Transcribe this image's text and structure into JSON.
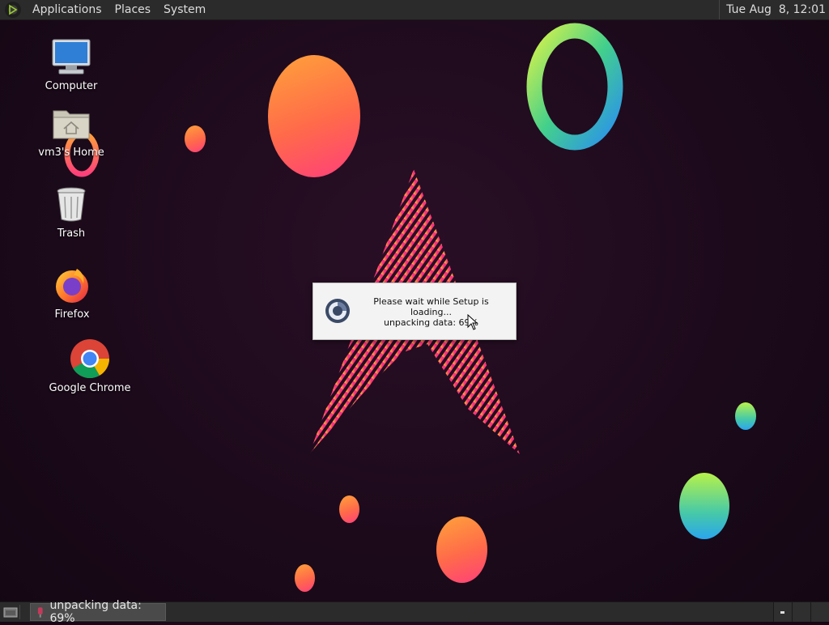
{
  "top_panel": {
    "menus": [
      "Applications",
      "Places",
      "System"
    ],
    "clock": "Tue Aug  8, 12:01"
  },
  "desktop": {
    "icons": [
      {
        "label": "Computer",
        "icon": "computer-icon"
      },
      {
        "label": "vm3's Home",
        "icon": "home-folder-icon"
      },
      {
        "label": "Trash",
        "icon": "trash-icon"
      },
      {
        "label": "Firefox",
        "icon": "firefox-icon"
      },
      {
        "label": "Google Chrome",
        "icon": "chrome-icon"
      }
    ]
  },
  "dialog": {
    "line1": "Please wait while Setup is loading...",
    "line2": "unpacking data: 69%",
    "icon": "setup-spinner-icon"
  },
  "taskbar": {
    "task_label": "unpacking data: 69%",
    "task_icon": "setup-app-icon",
    "show_desktop_icon": "show-desktop-icon"
  },
  "colors": {
    "panel_bg": "#2b2b2b",
    "wallpaper_bg": "#1c0a1b",
    "dialog_bg": "#f3f3f3"
  }
}
